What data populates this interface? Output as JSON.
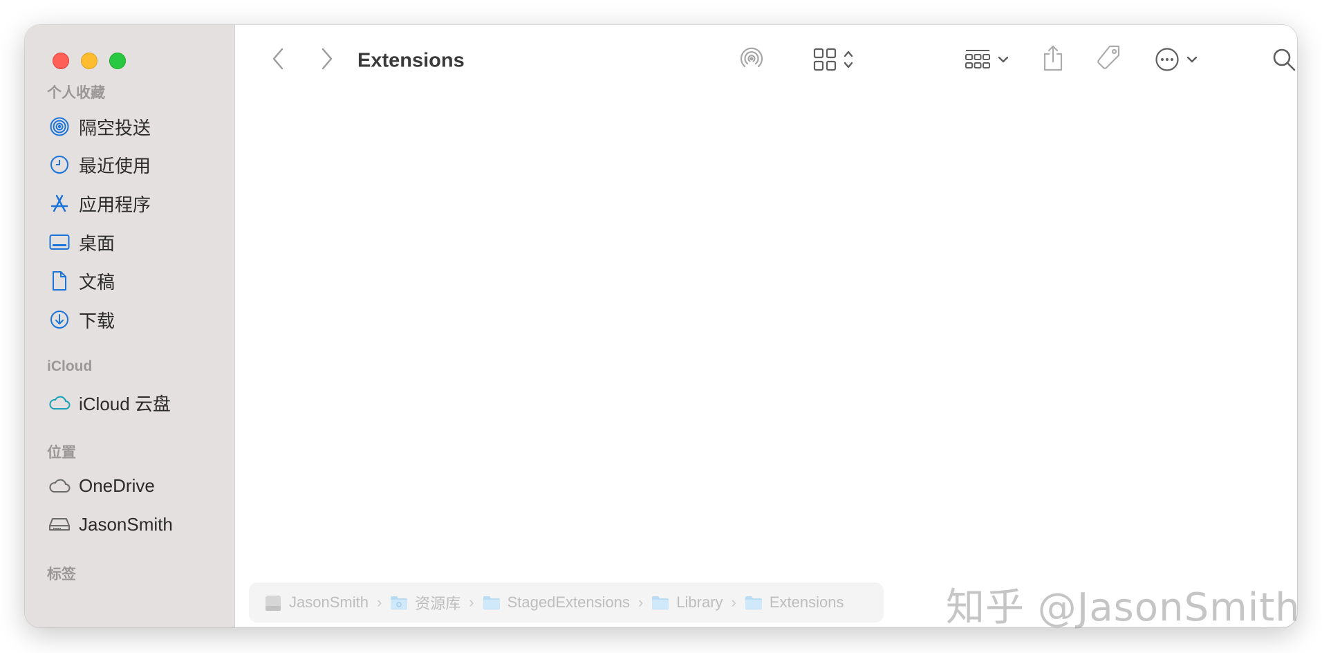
{
  "window": {
    "title": "Extensions"
  },
  "sidebar": {
    "favorites_title": "个人收藏",
    "favorites": [
      {
        "label": "隔空投送",
        "icon": "airdrop-icon"
      },
      {
        "label": "最近使用",
        "icon": "clock-icon"
      },
      {
        "label": "应用程序",
        "icon": "applications-icon"
      },
      {
        "label": "桌面",
        "icon": "desktop-icon"
      },
      {
        "label": "文稿",
        "icon": "document-icon"
      },
      {
        "label": "下载",
        "icon": "download-icon"
      }
    ],
    "icloud_title": "iCloud",
    "icloud": [
      {
        "label": "iCloud 云盘",
        "icon": "icloud-icon"
      }
    ],
    "locations_title": "位置",
    "locations": [
      {
        "label": "OneDrive",
        "icon": "cloud-icon"
      },
      {
        "label": "JasonSmith",
        "icon": "disk-icon"
      }
    ],
    "tags_title": "标签"
  },
  "toolbar": {
    "icons": [
      "back-icon",
      "forward-icon",
      "airdrop-icon",
      "icon-view-icon",
      "group-icon",
      "share-icon",
      "tag-icon",
      "more-icon",
      "search-icon"
    ]
  },
  "pathbar": {
    "crumbs": [
      "JasonSmith",
      "资源库",
      "StagedExtensions",
      "Library",
      "Extensions"
    ]
  },
  "watermark": "知乎 @JasonSmith",
  "colors": {
    "accent": "#1a73d9",
    "sidebar_bg": "#e4e0df",
    "close": "#fe5f57",
    "minimize": "#febc2e",
    "zoom": "#28c840"
  }
}
